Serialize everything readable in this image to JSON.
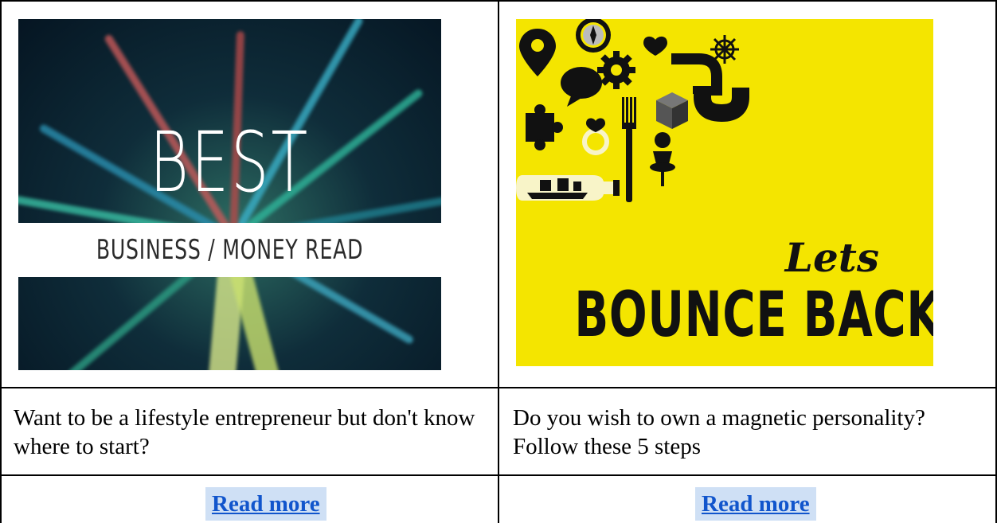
{
  "cards": [
    {
      "image": {
        "title": "BEST",
        "subtitle": "BUSINESS / MONEY READ"
      },
      "caption": "Want to be a lifestyle entrepreneur but don't know where to start?",
      "link_label": "Read more"
    },
    {
      "image": {
        "script_text": "Lets",
        "title": "BOUNCE BACK",
        "background_color": "#f4e500"
      },
      "caption": "Do you wish to own a magnetic personality? Follow these 5 steps",
      "link_label": "Read more"
    }
  ],
  "colors": {
    "link": "#1155cc",
    "link_highlight": "#cfe0f5",
    "border": "#000000"
  }
}
